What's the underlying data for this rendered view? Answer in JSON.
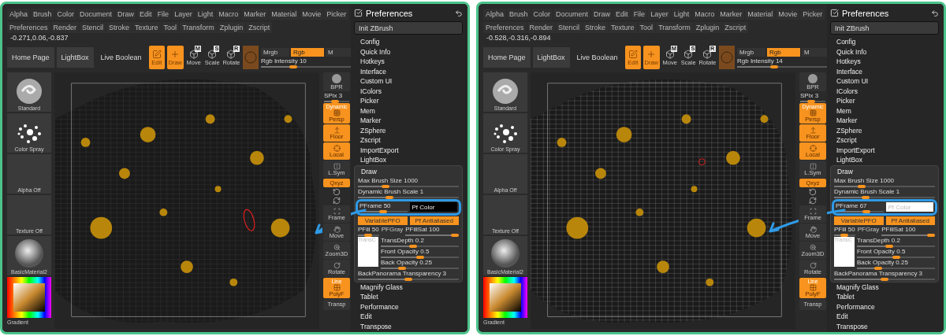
{
  "screens": [
    {
      "menu_rows": [
        [
          "Alpha",
          "Brush",
          "Color",
          "Document",
          "Draw",
          "Edit",
          "File",
          "Layer",
          "Light",
          "Macro",
          "Marker",
          "Material",
          "Movie",
          "Picker"
        ],
        [
          "Preferences",
          "Render",
          "Stencil",
          "Stroke",
          "Texture",
          "Tool",
          "Transform",
          "Zplugin",
          "Zscript"
        ]
      ],
      "coordinates": "-0.271,0.06,-0.837",
      "nav_buttons": [
        "Home Page",
        "LightBox",
        "Live Boolean"
      ],
      "tools": [
        {
          "label": "Edit",
          "selected": true
        },
        {
          "label": "Draw",
          "selected": true
        },
        {
          "label": "Move",
          "key": "M",
          "selected": false
        },
        {
          "label": "Scale",
          "key": "S",
          "selected": false
        },
        {
          "label": "Rotate",
          "key": "R",
          "selected": false
        }
      ],
      "color_modes": [
        {
          "label": "Mrgb",
          "selected": false
        },
        {
          "label": "Rgb",
          "selected": true
        },
        {
          "label": "M",
          "selected": false
        }
      ],
      "rgb_intensity": {
        "label": "Rgb Intensity 10",
        "level": 0.35
      },
      "left_shelf": [
        {
          "kind": "brush",
          "label": "Standard"
        },
        {
          "kind": "stroke",
          "label": "Color Spray"
        },
        {
          "kind": "empty",
          "label": "Alpha Off"
        },
        {
          "kind": "empty",
          "label": "Texture Off"
        },
        {
          "kind": "material",
          "label": "BasicMaterial2"
        }
      ],
      "gradient_label": "Gradient",
      "right_shelf": [
        {
          "kind": "sphere",
          "label": "BPR"
        },
        {
          "kind": "slider",
          "label": "SPix 3",
          "level": 0.4
        },
        {
          "kind": "button",
          "label": "Persp",
          "tag": "Dynamic",
          "active": true
        },
        {
          "kind": "button",
          "label": "Floor",
          "active": true
        },
        {
          "kind": "button",
          "label": "Local",
          "active": true
        },
        {
          "kind": "button",
          "label": "L.Sym",
          "active": false
        },
        {
          "kind": "toggle",
          "label": "Qxyz",
          "active": true
        },
        {
          "kind": "icon"
        },
        {
          "kind": "icon"
        },
        {
          "kind": "button",
          "label": "Frame",
          "active": false
        },
        {
          "kind": "button",
          "label": "Move",
          "active": false
        },
        {
          "kind": "button",
          "label": "Zoom3D",
          "active": false
        },
        {
          "kind": "button",
          "label": "Rotate",
          "active": false
        },
        {
          "kind": "button",
          "label": "PolyF",
          "tag": "Line",
          "active": true
        },
        {
          "kind": "small",
          "label": "Transp"
        }
      ],
      "preferences": {
        "title": "Preferences",
        "pinned": true,
        "init_button": "Init ZBrush",
        "items_before": [
          "Config",
          "Quick Info",
          "Hotkeys",
          "Interface",
          "Custom UI",
          "IColors",
          "Picker",
          "Mem",
          "Marker",
          "ZSphere",
          "Zscript",
          "ImportExport",
          "LightBox"
        ],
        "draw": {
          "title": "Draw",
          "max_brush": {
            "label": "Max Brush Size 1000",
            "level": 0.25
          },
          "dynamic_scale": {
            "label": "Dynamic Brush Scale 1",
            "level": 0.3
          },
          "pframe": {
            "label": "PFrame 50",
            "level": 0.5,
            "highlighted": true
          },
          "pf_color": {
            "label": "Pf Color",
            "color": "#000000"
          },
          "buttons": [
            "VariablePFO",
            "Pf Antialiased"
          ],
          "pfill": {
            "label": "PFill 50",
            "level": 0.5
          },
          "pfgray": "PFGray",
          "pfillsat": {
            "label": "PFillSat 100",
            "level": 1
          },
          "trans_swatch": "TransC",
          "trans_sliders": [
            {
              "label": "TransDepth 0.2",
              "level": 0.4
            },
            {
              "label": "Front Opacity 0.5",
              "level": 0.5
            },
            {
              "label": "Back Opacity 0.25",
              "level": 0.25
            }
          ],
          "back_panorama": {
            "label": "BackPanorama Transparency 3",
            "level": 0.5
          }
        },
        "items_after": [
          "Magnify Glass",
          "Tablet",
          "Performance",
          "Edit",
          "Transpose"
        ]
      }
    },
    {
      "menu_rows": [
        [
          "Alpha",
          "Brush",
          "Color",
          "Document",
          "Draw",
          "Edit",
          "File",
          "Layer",
          "Light",
          "Macro",
          "Marker",
          "Material",
          "Movie",
          "Picker"
        ],
        [
          "Preferences",
          "Render",
          "Stencil",
          "Stroke",
          "Texture",
          "Tool",
          "Transform",
          "Zplugin",
          "Zscript"
        ]
      ],
      "coordinates": "-0.528,-0.316,-0.894",
      "nav_buttons": [
        "Home Page",
        "LightBox",
        "Live Boolean"
      ],
      "tools": [
        {
          "label": "Edit",
          "selected": true
        },
        {
          "label": "Draw",
          "selected": true
        },
        {
          "label": "Move",
          "key": "M",
          "selected": false
        },
        {
          "label": "Scale",
          "key": "S",
          "selected": false
        },
        {
          "label": "Rotate",
          "key": "R",
          "selected": false
        }
      ],
      "color_modes": [
        {
          "label": "Mrgb",
          "selected": false
        },
        {
          "label": "Rgb",
          "selected": true
        },
        {
          "label": "M",
          "selected": false
        }
      ],
      "rgb_intensity": {
        "label": "Rgb Intensity 14",
        "level": 0.4
      },
      "left_shelf": [
        {
          "kind": "brush",
          "label": "Standard"
        },
        {
          "kind": "stroke",
          "label": "Color Spray"
        },
        {
          "kind": "empty",
          "label": "Alpha Off"
        },
        {
          "kind": "empty",
          "label": "Texture Off"
        },
        {
          "kind": "material",
          "label": "BasicMaterial2"
        }
      ],
      "gradient_label": "Gradient",
      "right_shelf": [
        {
          "kind": "sphere",
          "label": "BPR"
        },
        {
          "kind": "slider",
          "label": "SPix 3",
          "level": 0.4
        },
        {
          "kind": "button",
          "label": "Persp",
          "tag": "Dynamic",
          "active": true
        },
        {
          "kind": "button",
          "label": "Floor",
          "active": true
        },
        {
          "kind": "button",
          "label": "Local",
          "active": true
        },
        {
          "kind": "button",
          "label": "L.Sym",
          "active": false
        },
        {
          "kind": "toggle",
          "label": "Qxyz",
          "active": true
        },
        {
          "kind": "icon"
        },
        {
          "kind": "icon"
        },
        {
          "kind": "button",
          "label": "Frame",
          "active": false
        },
        {
          "kind": "button",
          "label": "Move",
          "active": false
        },
        {
          "kind": "button",
          "label": "Zoom3D",
          "active": false
        },
        {
          "kind": "button",
          "label": "Rotate",
          "active": false
        },
        {
          "kind": "button",
          "label": "PolyF",
          "tag": "Line",
          "active": true
        },
        {
          "kind": "small",
          "label": "Transp"
        }
      ],
      "preferences": {
        "title": "Preferences",
        "pinned": true,
        "init_button": "Init ZBrush",
        "items_before": [
          "Config",
          "Quick Info",
          "Hotkeys",
          "Interface",
          "Custom UI",
          "IColors",
          "Picker",
          "Mem",
          "Marker",
          "ZSphere",
          "Zscript",
          "ImportExport",
          "LightBox"
        ],
        "draw": {
          "title": "Draw",
          "max_brush": {
            "label": "Max Brush Size 1000",
            "level": 0.25
          },
          "dynamic_scale": {
            "label": "Dynamic Brush Scale 1",
            "level": 0.3
          },
          "pframe": {
            "label": "PFrame 67",
            "level": 0.67,
            "highlighted": true
          },
          "pf_color": {
            "label": "Pf Color",
            "color": "#ffffff"
          },
          "buttons": [
            "VariablePFO",
            "Pf Antialiased"
          ],
          "pfill": {
            "label": "PFill 50",
            "level": 0.5
          },
          "pfgray": "PFGray",
          "pfillsat": {
            "label": "PFillSat 100",
            "level": 1
          },
          "trans_swatch": "TransC",
          "trans_sliders": [
            {
              "label": "TransDepth 0.2",
              "level": 0.4
            },
            {
              "label": "Front Opacity 0.5",
              "level": 0.5
            },
            {
              "label": "Back Opacity 0.25",
              "level": 0.25
            }
          ],
          "back_panorama": {
            "label": "BackPanorama Transparency 3",
            "level": 0.5
          }
        },
        "items_after": [
          "Magnify Glass",
          "Tablet",
          "Performance",
          "Edit",
          "Transpose"
        ]
      }
    }
  ]
}
